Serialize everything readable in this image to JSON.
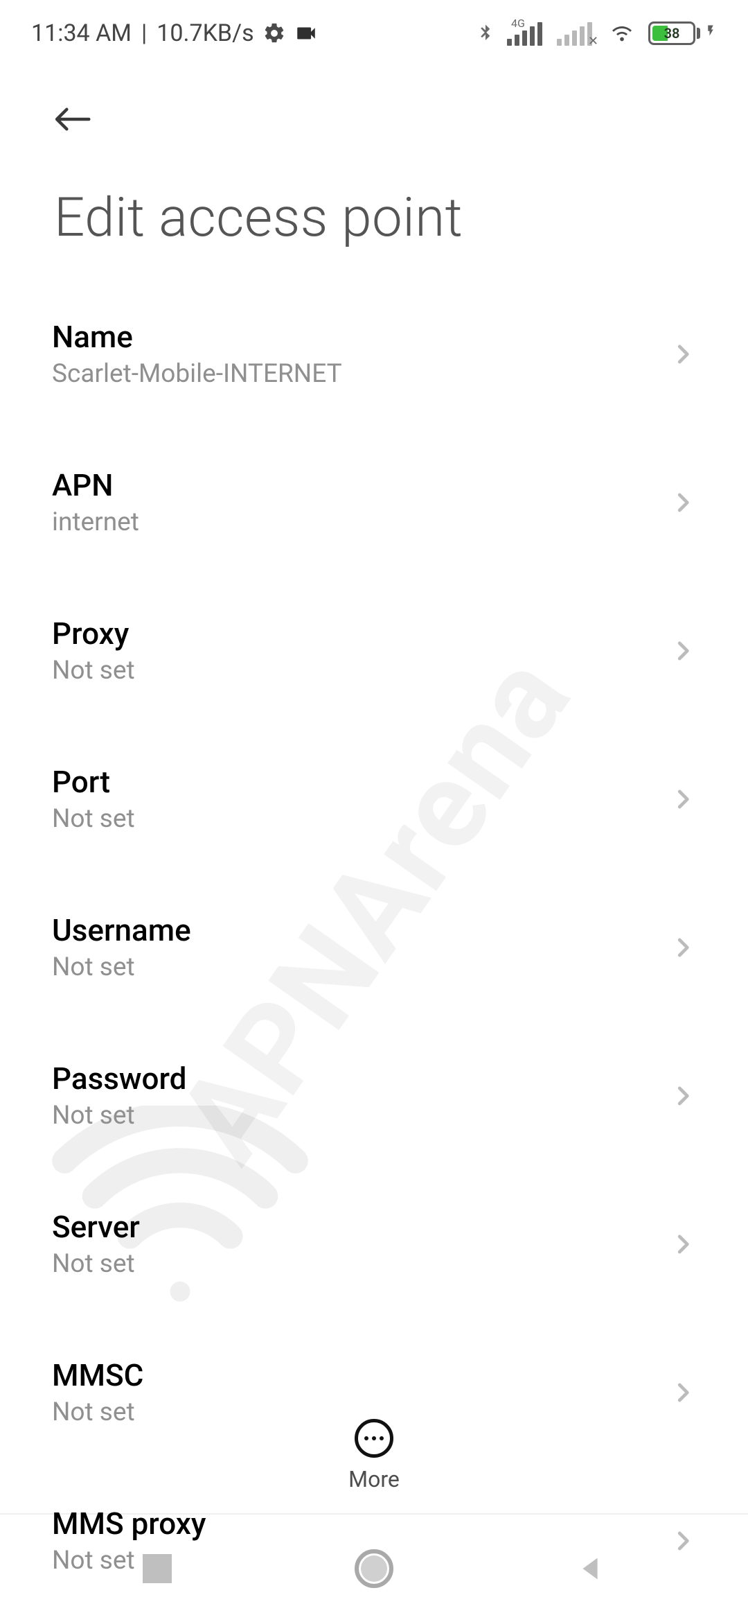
{
  "status_bar": {
    "time": "11:34 AM",
    "speed": "10.7KB/s",
    "network_label": "4G",
    "battery_pct": "38",
    "battery_fill_pct": 38
  },
  "page": {
    "title": "Edit access point"
  },
  "rows": [
    {
      "label": "Name",
      "value": "Scarlet-Mobile-INTERNET"
    },
    {
      "label": "APN",
      "value": "internet"
    },
    {
      "label": "Proxy",
      "value": "Not set"
    },
    {
      "label": "Port",
      "value": "Not set"
    },
    {
      "label": "Username",
      "value": "Not set"
    },
    {
      "label": "Password",
      "value": "Not set"
    },
    {
      "label": "Server",
      "value": "Not set"
    },
    {
      "label": "MMSC",
      "value": "Not set"
    },
    {
      "label": "MMS proxy",
      "value": "Not set"
    }
  ],
  "more_bar": {
    "label": "More"
  },
  "watermark": {
    "text": "APNArena"
  }
}
